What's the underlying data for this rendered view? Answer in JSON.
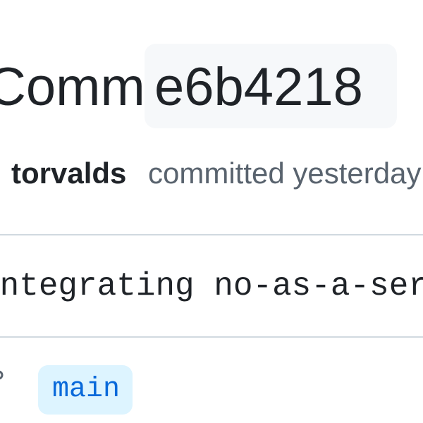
{
  "header": {
    "title_word": "Commit",
    "sha": "e6b4218"
  },
  "meta": {
    "author": "torvalds",
    "action": "committed yesterday"
  },
  "commit": {
    "message": "Integrating no-as-a-service"
  },
  "branch": {
    "icon": "git-branch-icon",
    "name": "main"
  },
  "colors": {
    "text_primary": "#1f2328",
    "text_muted": "#59636e",
    "sha_chip_bg": "#f6f8fa",
    "divider": "#d1d9e0",
    "branch_chip_bg": "#ddf4ff",
    "branch_text": "#0969da"
  }
}
